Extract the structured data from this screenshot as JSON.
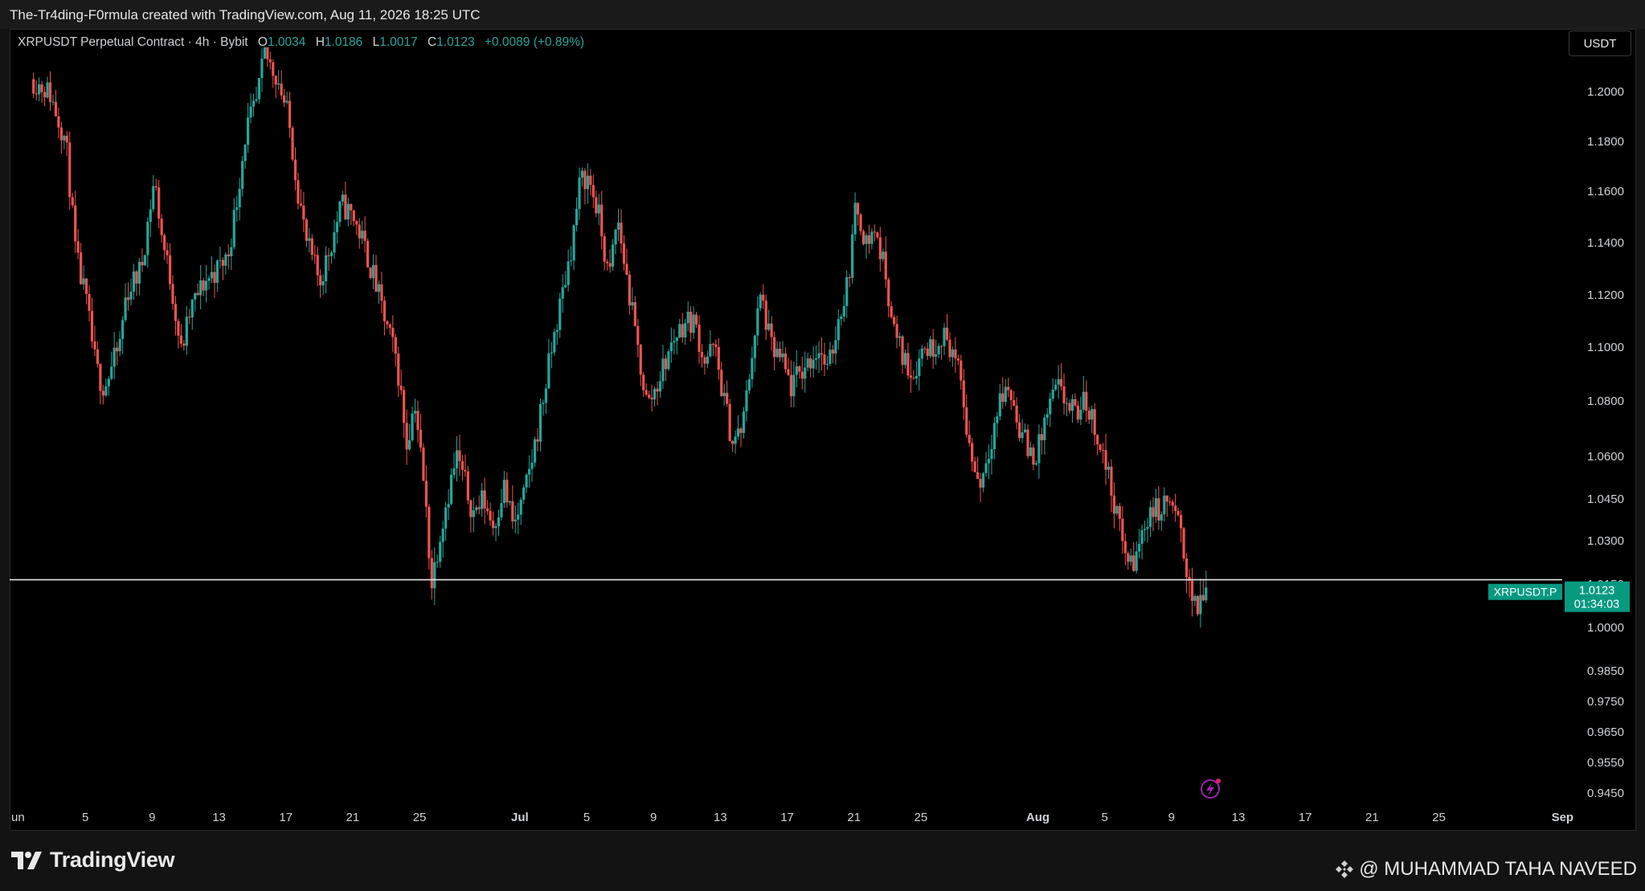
{
  "header": {
    "attribution": "The-Tr4ding-F0rmula created with TradingView.com, Aug 11, 2026 18:25 UTC"
  },
  "legend": {
    "symbol_line": "XRPUSDT Perpetual Contract · 4h · Bybit",
    "open_label": "O",
    "open_value": "1.0034",
    "high_label": "H",
    "high_value": "1.0186",
    "low_label": "L",
    "low_value": "1.0017",
    "close_label": "C",
    "close_value": "1.0123",
    "change": "+0.0089 (+0.89%)"
  },
  "toolbar": {
    "currency_label": "USDT"
  },
  "price_tag": {
    "symbol": "XRPUSDT.P",
    "price": "1.0123",
    "countdown": "01:34:03"
  },
  "footer": {
    "logo_text": "TradingView",
    "author": "@ MUHAMMAD TAHA NAVEED"
  },
  "colors": {
    "up": "#26a69a",
    "down": "#ef5350",
    "background": "#000000",
    "line": "#e6e6e6",
    "tag": "#089981"
  },
  "chart_data": {
    "type": "candlestick",
    "interval": "4h",
    "price_axis_ticks": [
      {
        "value": 1.2,
        "label": "1.2000"
      },
      {
        "value": 1.18,
        "label": "1.1800"
      },
      {
        "value": 1.16,
        "label": "1.1600"
      },
      {
        "value": 1.14,
        "label": "1.1400"
      },
      {
        "value": 1.12,
        "label": "1.1200"
      },
      {
        "value": 1.1,
        "label": "1.1000"
      },
      {
        "value": 1.08,
        "label": "1.0800"
      },
      {
        "value": 1.06,
        "label": "1.0600"
      },
      {
        "value": 1.045,
        "label": "1.0450"
      },
      {
        "value": 1.03,
        "label": "1.0300"
      },
      {
        "value": 1.015,
        "label": "1.0150"
      },
      {
        "value": 1.0,
        "label": "1.0000"
      },
      {
        "value": 0.985,
        "label": "0.9850"
      },
      {
        "value": 0.975,
        "label": "0.9750"
      },
      {
        "value": 0.965,
        "label": "0.9650"
      },
      {
        "value": 0.955,
        "label": "0.9550"
      },
      {
        "value": 0.945,
        "label": "0.9450"
      }
    ],
    "time_axis_ticks": [
      {
        "day": 1,
        "label": "un"
      },
      {
        "day": 5,
        "label": "5"
      },
      {
        "day": 9,
        "label": "9"
      },
      {
        "day": 13,
        "label": "13"
      },
      {
        "day": 17,
        "label": "17"
      },
      {
        "day": 21,
        "label": "21"
      },
      {
        "day": 25,
        "label": "25"
      },
      {
        "day": 31,
        "label": "Jul"
      },
      {
        "day": 35,
        "label": "5"
      },
      {
        "day": 39,
        "label": "9"
      },
      {
        "day": 43,
        "label": "13"
      },
      {
        "day": 47,
        "label": "17"
      },
      {
        "day": 51,
        "label": "21"
      },
      {
        "day": 55,
        "label": "25"
      },
      {
        "day": 62,
        "label": "Aug"
      },
      {
        "day": 66,
        "label": "5"
      },
      {
        "day": 70,
        "label": "9"
      },
      {
        "day": 74,
        "label": "13"
      },
      {
        "day": 78,
        "label": "17"
      },
      {
        "day": 82,
        "label": "21"
      },
      {
        "day": 86,
        "label": "25"
      },
      {
        "day": 93,
        "label": "Sep"
      }
    ],
    "horizontal_line": {
      "value": 1.0165
    },
    "last_price": 1.0123,
    "path_points": [
      {
        "day": 1.9,
        "price": 1.205
      },
      {
        "day": 3.0,
        "price": 1.2
      },
      {
        "day": 4.0,
        "price": 1.18
      },
      {
        "day": 4.6,
        "price": 1.135
      },
      {
        "day": 5.2,
        "price": 1.118
      },
      {
        "day": 5.8,
        "price": 1.092
      },
      {
        "day": 6.3,
        "price": 1.085
      },
      {
        "day": 7.2,
        "price": 1.1
      },
      {
        "day": 7.6,
        "price": 1.12
      },
      {
        "day": 8.5,
        "price": 1.13
      },
      {
        "day": 9.3,
        "price": 1.165
      },
      {
        "day": 9.8,
        "price": 1.14
      },
      {
        "day": 10.3,
        "price": 1.125
      },
      {
        "day": 10.9,
        "price": 1.098
      },
      {
        "day": 11.5,
        "price": 1.115
      },
      {
        "day": 12.3,
        "price": 1.125
      },
      {
        "day": 13.1,
        "price": 1.13
      },
      {
        "day": 13.7,
        "price": 1.135
      },
      {
        "day": 14.2,
        "price": 1.155
      },
      {
        "day": 14.8,
        "price": 1.185
      },
      {
        "day": 15.4,
        "price": 1.195
      },
      {
        "day": 15.9,
        "price": 1.215
      },
      {
        "day": 16.7,
        "price": 1.205
      },
      {
        "day": 17.3,
        "price": 1.19
      },
      {
        "day": 17.9,
        "price": 1.16
      },
      {
        "day": 18.4,
        "price": 1.14
      },
      {
        "day": 19.2,
        "price": 1.125
      },
      {
        "day": 19.9,
        "price": 1.14
      },
      {
        "day": 20.5,
        "price": 1.155
      },
      {
        "day": 21.2,
        "price": 1.15
      },
      {
        "day": 21.8,
        "price": 1.14
      },
      {
        "day": 22.5,
        "price": 1.125
      },
      {
        "day": 23.1,
        "price": 1.11
      },
      {
        "day": 23.8,
        "price": 1.095
      },
      {
        "day": 24.4,
        "price": 1.065
      },
      {
        "day": 24.9,
        "price": 1.08
      },
      {
        "day": 25.5,
        "price": 1.045
      },
      {
        "day": 25.9,
        "price": 1.015
      },
      {
        "day": 26.3,
        "price": 1.03
      },
      {
        "day": 26.8,
        "price": 1.045
      },
      {
        "day": 27.4,
        "price": 1.06
      },
      {
        "day": 27.9,
        "price": 1.05
      },
      {
        "day": 28.4,
        "price": 1.04
      },
      {
        "day": 29.0,
        "price": 1.045
      },
      {
        "day": 29.6,
        "price": 1.035
      },
      {
        "day": 30.2,
        "price": 1.05
      },
      {
        "day": 30.8,
        "price": 1.035
      },
      {
        "day": 31.4,
        "price": 1.045
      },
      {
        "day": 32.0,
        "price": 1.062
      },
      {
        "day": 32.6,
        "price": 1.082
      },
      {
        "day": 33.1,
        "price": 1.1
      },
      {
        "day": 33.7,
        "price": 1.12
      },
      {
        "day": 34.3,
        "price": 1.14
      },
      {
        "day": 34.8,
        "price": 1.165
      },
      {
        "day": 35.3,
        "price": 1.165
      },
      {
        "day": 35.9,
        "price": 1.15
      },
      {
        "day": 36.5,
        "price": 1.125
      },
      {
        "day": 37.0,
        "price": 1.15
      },
      {
        "day": 37.6,
        "price": 1.125
      },
      {
        "day": 38.2,
        "price": 1.1
      },
      {
        "day": 38.8,
        "price": 1.078
      },
      {
        "day": 39.3,
        "price": 1.085
      },
      {
        "day": 39.9,
        "price": 1.095
      },
      {
        "day": 40.5,
        "price": 1.105
      },
      {
        "day": 41.1,
        "price": 1.11
      },
      {
        "day": 41.6,
        "price": 1.11
      },
      {
        "day": 42.2,
        "price": 1.095
      },
      {
        "day": 42.8,
        "price": 1.1
      },
      {
        "day": 43.4,
        "price": 1.08
      },
      {
        "day": 43.9,
        "price": 1.065
      },
      {
        "day": 44.5,
        "price": 1.07
      },
      {
        "day": 45.1,
        "price": 1.1
      },
      {
        "day": 45.6,
        "price": 1.12
      },
      {
        "day": 46.2,
        "price": 1.1
      },
      {
        "day": 46.8,
        "price": 1.095
      },
      {
        "day": 47.4,
        "price": 1.085
      },
      {
        "day": 47.9,
        "price": 1.09
      },
      {
        "day": 48.5,
        "price": 1.095
      },
      {
        "day": 49.1,
        "price": 1.1
      },
      {
        "day": 49.6,
        "price": 1.09
      },
      {
        "day": 50.2,
        "price": 1.11
      },
      {
        "day": 50.8,
        "price": 1.125
      },
      {
        "day": 51.3,
        "price": 1.155
      },
      {
        "day": 51.9,
        "price": 1.14
      },
      {
        "day": 52.4,
        "price": 1.145
      },
      {
        "day": 53.0,
        "price": 1.13
      },
      {
        "day": 53.6,
        "price": 1.105
      },
      {
        "day": 54.2,
        "price": 1.095
      },
      {
        "day": 54.7,
        "price": 1.09
      },
      {
        "day": 55.3,
        "price": 1.1
      },
      {
        "day": 55.9,
        "price": 1.1
      },
      {
        "day": 56.4,
        "price": 1.105
      },
      {
        "day": 57.0,
        "price": 1.1
      },
      {
        "day": 57.6,
        "price": 1.085
      },
      {
        "day": 58.1,
        "price": 1.062
      },
      {
        "day": 58.7,
        "price": 1.05
      },
      {
        "day": 59.3,
        "price": 1.065
      },
      {
        "day": 59.9,
        "price": 1.08
      },
      {
        "day": 60.4,
        "price": 1.085
      },
      {
        "day": 61.0,
        "price": 1.072
      },
      {
        "day": 61.6,
        "price": 1.062
      },
      {
        "day": 62.1,
        "price": 1.06
      },
      {
        "day": 62.7,
        "price": 1.075
      },
      {
        "day": 63.3,
        "price": 1.085
      },
      {
        "day": 63.8,
        "price": 1.08
      },
      {
        "day": 64.4,
        "price": 1.075
      },
      {
        "day": 65.0,
        "price": 1.08
      },
      {
        "day": 65.5,
        "price": 1.072
      },
      {
        "day": 66.1,
        "price": 1.06
      },
      {
        "day": 66.7,
        "price": 1.045
      },
      {
        "day": 67.2,
        "price": 1.03
      },
      {
        "day": 67.8,
        "price": 1.02
      },
      {
        "day": 68.3,
        "price": 1.03
      },
      {
        "day": 68.9,
        "price": 1.042
      },
      {
        "day": 69.5,
        "price": 1.04
      },
      {
        "day": 70.0,
        "price": 1.045
      },
      {
        "day": 70.6,
        "price": 1.035
      },
      {
        "day": 71.1,
        "price": 1.02
      },
      {
        "day": 71.6,
        "price": 1.005
      },
      {
        "day": 72.1,
        "price": 1.0125
      }
    ]
  }
}
